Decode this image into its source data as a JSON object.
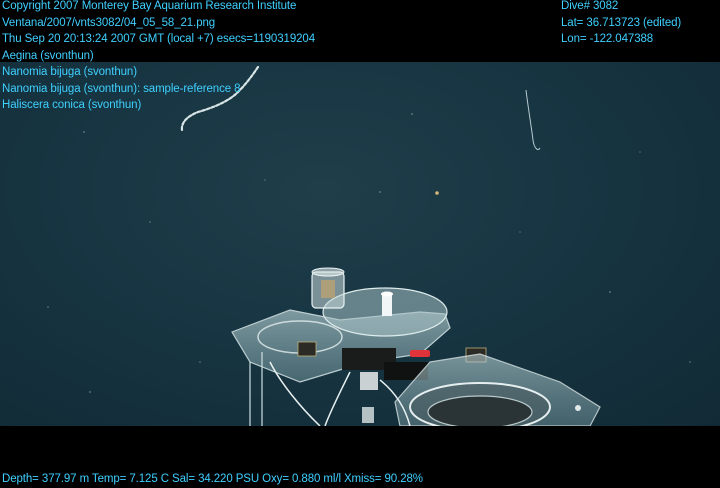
{
  "header_left": [
    "Copyright 2007 Monterey Bay Aquarium Research Institute",
    "Ventana/2007/vnts3082/04_05_58_21.png",
    "Thu Sep 20 20:13:24 2007 GMT (local +7)  esecs=1190319204",
    "Aegina (svonthun)",
    "Nanomia bijuga (svonthun)",
    "Nanomia bijuga (svonthun): sample-reference 8",
    "Haliscera conica (svonthun)"
  ],
  "header_right": [
    "Dive# 3082",
    "Lat= 36.713723 (edited)",
    "Lon= -122.047388"
  ],
  "footer": "Depth= 377.97 m  Temp= 7.125 C  Sal= 34.220 PSU  Oxy= 0.880 ml/l  Xmiss= 90.28%",
  "colors": {
    "overlay_text": "#3fd0ff",
    "water": "#173542",
    "frame": "#000000"
  }
}
